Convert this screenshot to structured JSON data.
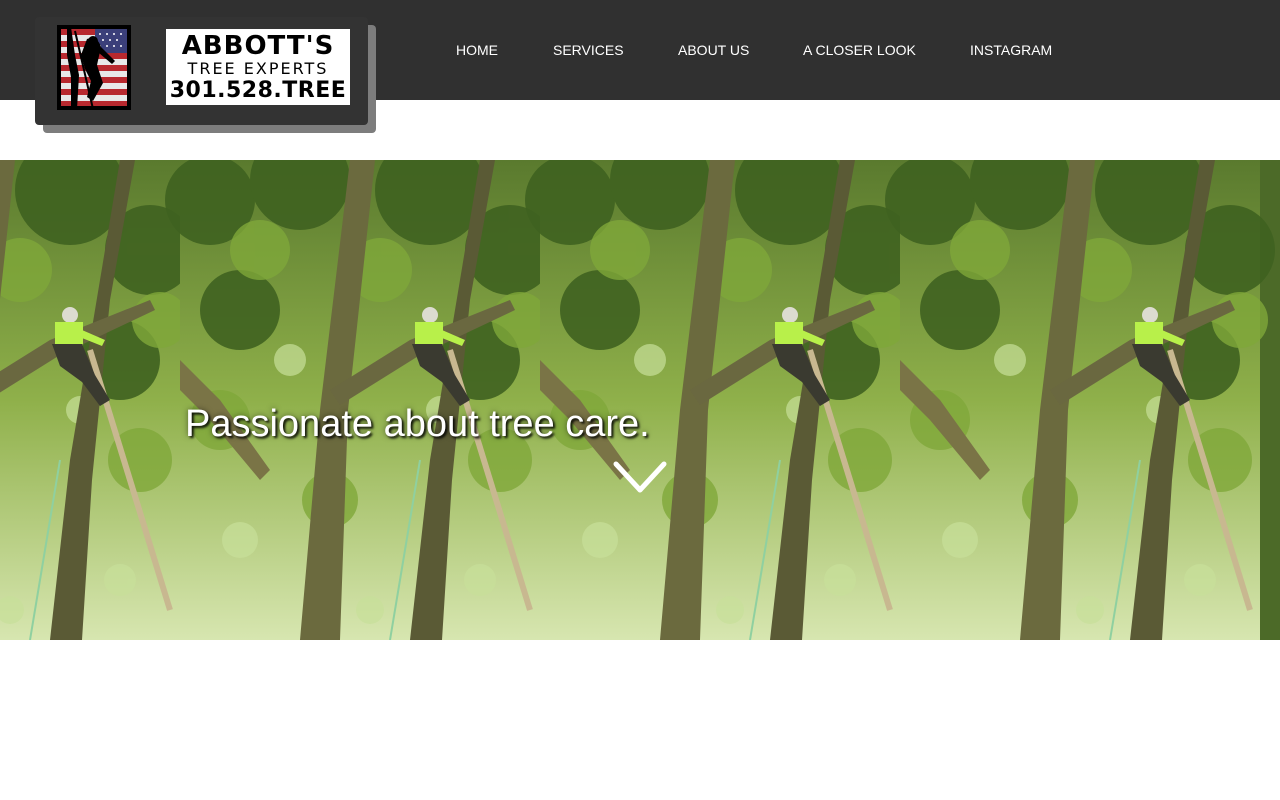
{
  "header": {
    "brand_line1": "ABBOTT'S",
    "brand_line2": "TREE EXPERTS",
    "brand_line3": "301.528.TREE",
    "background": "#303030"
  },
  "nav": {
    "items": [
      {
        "label": "HOME"
      },
      {
        "label": "SERVICES"
      },
      {
        "label": "ABOUT US"
      },
      {
        "label": "A CLOSER LOOK"
      },
      {
        "label": "INSTAGRAM"
      }
    ]
  },
  "hero": {
    "headline": "Passionate about tree care.",
    "scroll_icon": "chevron-down-icon"
  },
  "icons": {
    "flag_logo": "climber-flag-logo"
  }
}
